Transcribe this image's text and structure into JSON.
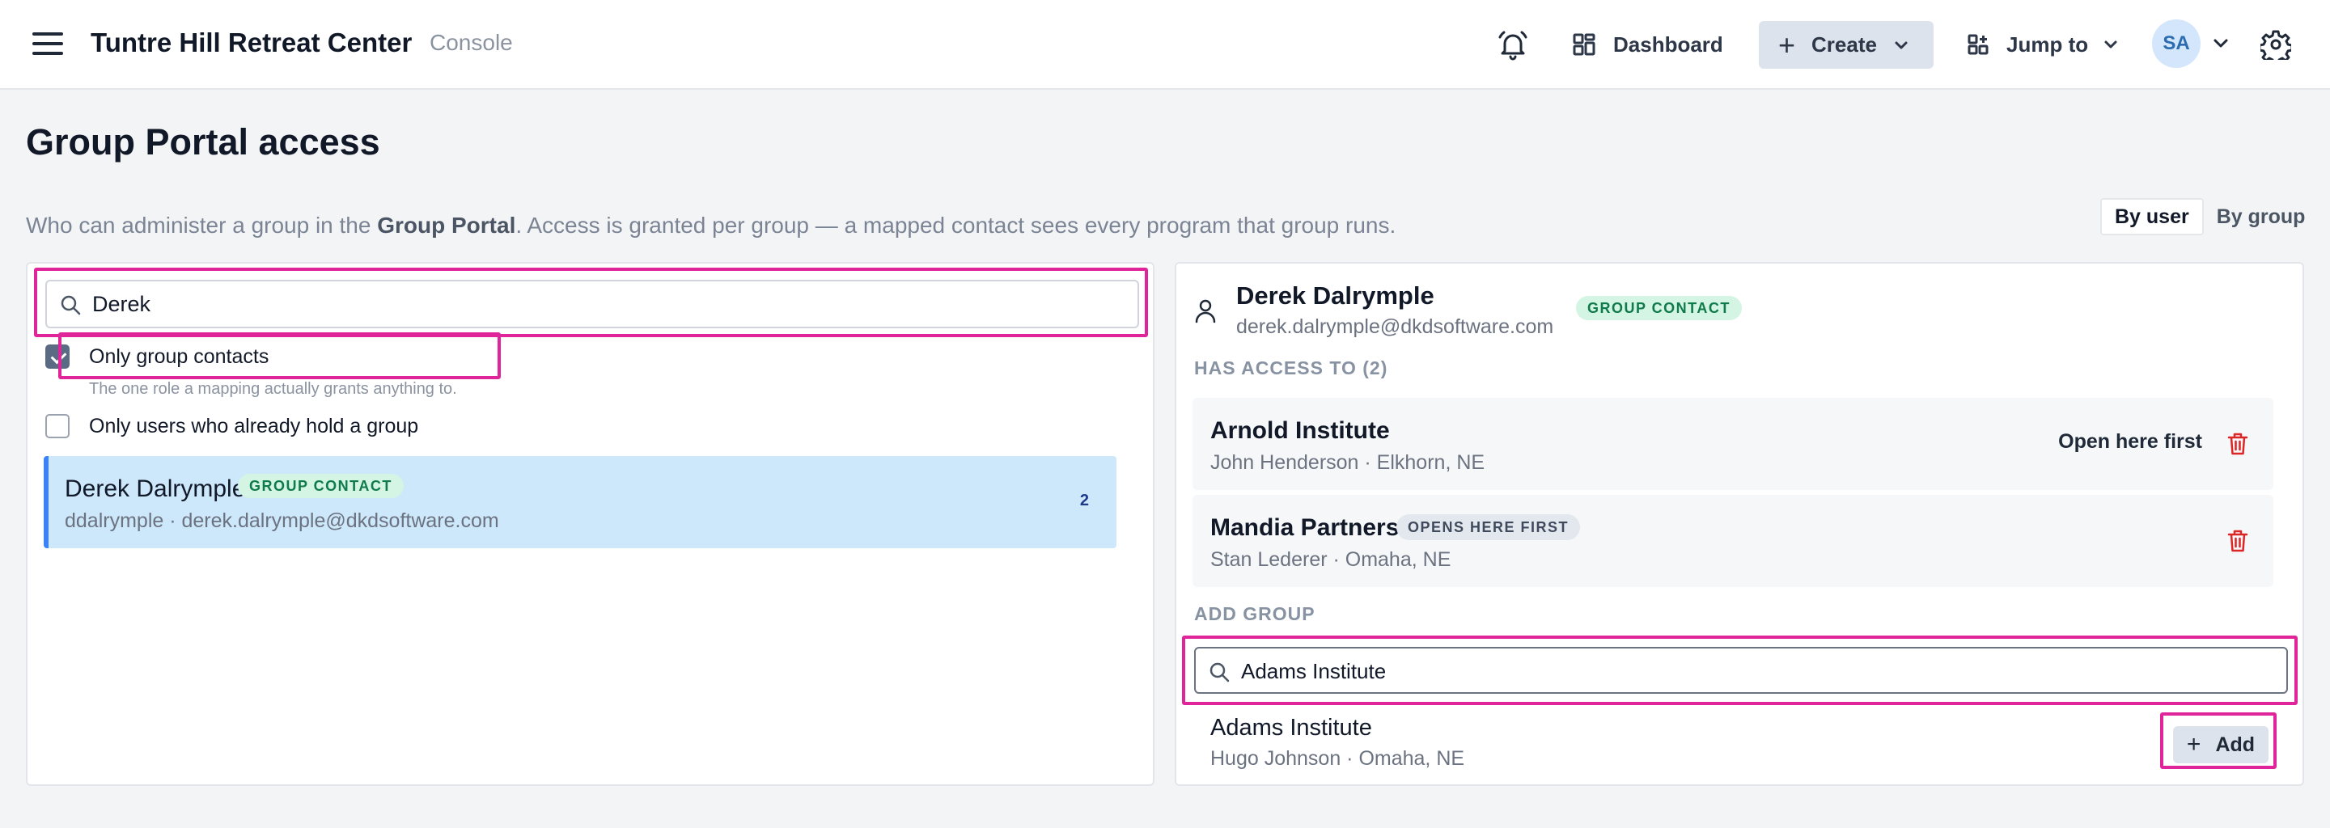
{
  "header": {
    "app_title": "Tuntre Hill Retreat Center",
    "app_subtitle": "Console",
    "nav": {
      "dashboard_label": "Dashboard",
      "create_label": "Create",
      "jump_label": "Jump to",
      "avatar_initials": "SA"
    },
    "icons": [
      "menu-icon",
      "bell-icon",
      "dashboard-icon",
      "plus-icon",
      "chevron-down-icon",
      "jump-to-icon",
      "gear-icon"
    ]
  },
  "page": {
    "title": "Group Portal access",
    "intro_before": "Who can administer a group in the ",
    "intro_bold": "Group Portal",
    "intro_after": ". Access is granted per group — a mapped contact sees every program that group runs.",
    "view_toggle": {
      "by_user": "By user",
      "by_group": "By group",
      "active": "By user"
    }
  },
  "left": {
    "search": {
      "value": "Derek",
      "placeholder": ""
    },
    "filters": {
      "only_group_contacts": {
        "label": "Only group contacts",
        "hint": "The one role a mapping actually grants anything to.",
        "checked": true
      },
      "only_holders": {
        "label": "Only users who already hold a group",
        "checked": false
      }
    },
    "results": [
      {
        "name": "Derek Dalrymple",
        "badge": "GROUP CONTACT",
        "meta": "ddalrymple · derek.dalrymple@dkdsoftware.com",
        "count": "2",
        "selected": true
      }
    ]
  },
  "right": {
    "user": {
      "name": "Derek Dalrymple",
      "email": "derek.dalrymple@dkdsoftware.com",
      "badge": "GROUP CONTACT"
    },
    "has_access_heading": "HAS ACCESS TO (2)",
    "groups": [
      {
        "name": "Arnold Institute",
        "meta": "John Henderson · Elkhorn, NE",
        "action": "Open here first"
      },
      {
        "name": "Mandia Partners",
        "badge": "OPENS HERE FIRST",
        "meta": "Stan Lederer · Omaha, NE"
      }
    ],
    "add_group_heading": "ADD GROUP",
    "add_search": {
      "value": "Adams Institute",
      "placeholder": ""
    },
    "add_results": [
      {
        "name": "Adams Institute",
        "meta": "Hugo Johnson · Omaha, NE",
        "add_label": "Add"
      }
    ]
  },
  "colors": {
    "highlight": "#e0249a",
    "selected_row_bg": "#cde7fb",
    "selected_row_accent": "#3b82f6",
    "badge_green_bg": "#d4f5e4",
    "badge_green_text": "#0f7a4a",
    "trash_red": "#dc2626"
  }
}
